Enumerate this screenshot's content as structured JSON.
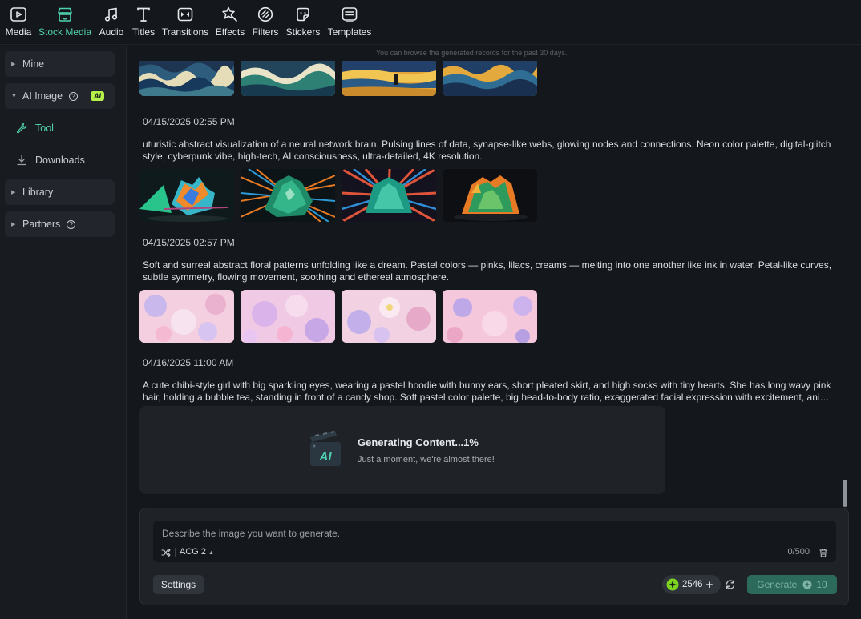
{
  "toolbar": {
    "items": [
      {
        "label": "Media",
        "icon": "media-icon"
      },
      {
        "label": "Stock Media",
        "icon": "stock-media-icon",
        "active": true
      },
      {
        "label": "Audio",
        "icon": "audio-icon"
      },
      {
        "label": "Titles",
        "icon": "titles-icon"
      },
      {
        "label": "Transitions",
        "icon": "transitions-icon"
      },
      {
        "label": "Effects",
        "icon": "effects-icon"
      },
      {
        "label": "Filters",
        "icon": "filters-icon"
      },
      {
        "label": "Stickers",
        "icon": "stickers-icon"
      },
      {
        "label": "Templates",
        "icon": "templates-icon"
      }
    ]
  },
  "sidebar": {
    "mine": "Mine",
    "ai_image": "AI Image",
    "ai_badge": "AI",
    "tool": "Tool",
    "downloads": "Downloads",
    "library": "Library",
    "partners": "Partners"
  },
  "main": {
    "note": "You can browse the generated records for the past 30 days.",
    "records": [
      {
        "date": "04/15/2025 02:55 PM",
        "prompt": "uturistic abstract visualization of a neural network brain. Pulsing lines of data, synapse-like webs, glowing nodes and connections. Neon color palette, digital-glitch style, cyberpunk vibe, high-tech, AI consciousness, ultra-detailed, 4K resolution."
      },
      {
        "date": "04/15/2025 02:57 PM",
        "prompt": "Soft and surreal abstract floral patterns unfolding like a dream. Pastel colors — pinks, lilacs, creams — melting into one another like ink in water. Petal-like curves, subtle symmetry, flowing movement, soothing and ethereal atmosphere."
      },
      {
        "date": "04/16/2025 11:00 AM",
        "prompt": "A cute chibi-style girl with big sparkling eyes, wearing a pastel hoodie with bunny ears, short pleated skirt, and high socks with tiny hearts. She has long wavy pink hair, holding a bubble tea, standing in front of a candy shop. Soft pastel color palette, big head-to-body ratio, exaggerated facial expression with excitement, anime style."
      }
    ],
    "generating": {
      "title": "Generating Content...1%",
      "subtitle": "Just a moment, we're almost there!",
      "icon_text": "AI"
    }
  },
  "panel": {
    "placeholder": "Describe the image you want to generate.",
    "model": "ACG 2",
    "char_count": "0/500",
    "settings": "Settings",
    "credits": "2546",
    "generate": "Generate",
    "generate_cost": "10"
  },
  "colors": {
    "accent": "#4fd1b0",
    "background": "#14171b",
    "panel": "#1f2328",
    "ai_badge": "#b6f04a",
    "generate_button": "#2c6b5c"
  }
}
